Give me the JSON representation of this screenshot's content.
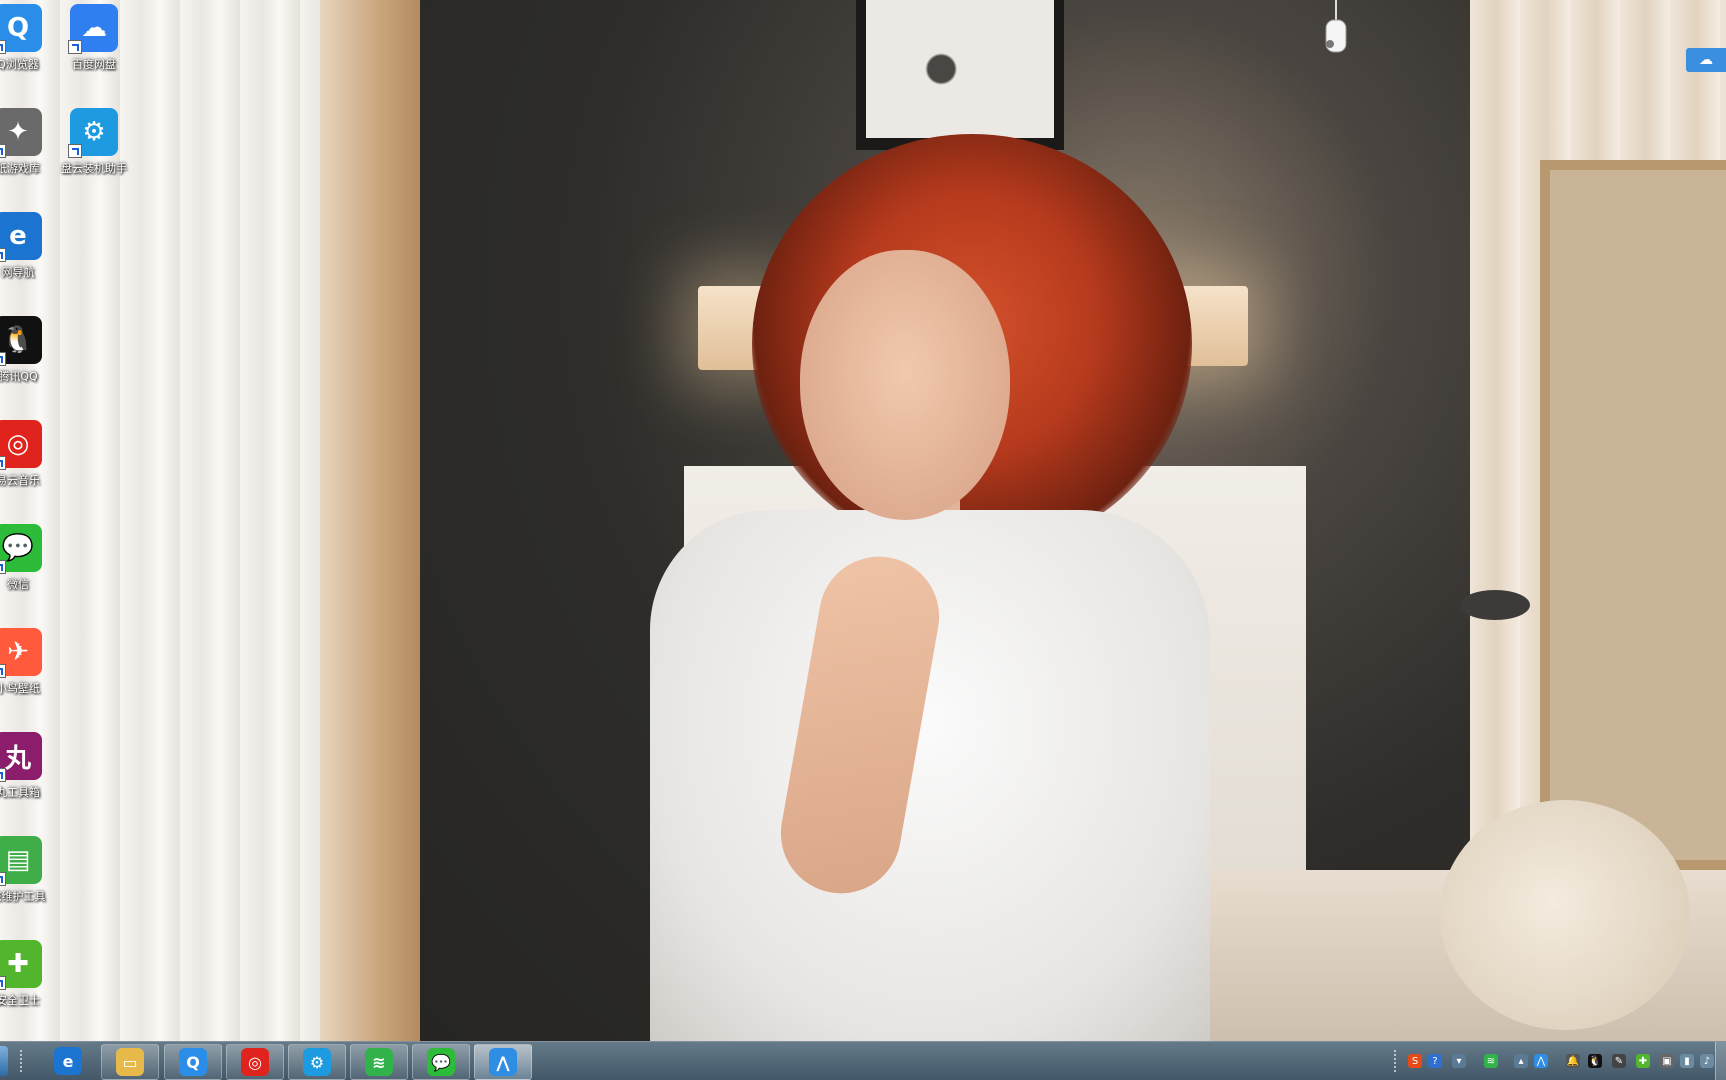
{
  "desktop": {
    "icons": [
      {
        "label": "Q浏览器",
        "icon": "qq-browser-icon",
        "color": "#2a8de8",
        "glyph": "Q"
      },
      {
        "label": "百度网盘",
        "icon": "baidu-netdisk-icon",
        "color": "#2f7ff0",
        "glyph": "☁"
      },
      {
        "label": "纸游戏库",
        "icon": "game-library-icon",
        "color": "#6a6a6a",
        "glyph": "✦"
      },
      {
        "label": "盘云装机助手",
        "icon": "install-helper-icon",
        "color": "#1e9be0",
        "glyph": "⚙"
      },
      {
        "label": "网导航",
        "icon": "ie-navigation-icon",
        "color": "#1b74d0",
        "glyph": "e"
      },
      {
        "label": "腾讯QQ",
        "icon": "qq-penguin-icon",
        "color": "#111111",
        "glyph": "🐧"
      },
      {
        "label": "易云音乐",
        "icon": "netease-music-icon",
        "color": "#e0231c",
        "glyph": "◎"
      },
      {
        "label": "微信",
        "icon": "wechat-icon",
        "color": "#2dbb3a",
        "glyph": "💬"
      },
      {
        "label": "小鸟壁纸",
        "icon": "bird-wallpaper-icon",
        "color": "#ff5a3c",
        "glyph": "✈"
      },
      {
        "label": "丸工具箱",
        "icon": "toolbox-icon",
        "color": "#8c1d6d",
        "glyph": "丸"
      },
      {
        "label": "统维护工具",
        "icon": "maintenance-tool-icon",
        "color": "#3fae49",
        "glyph": "▤"
      },
      {
        "label": "安全卫士",
        "icon": "security-guard-icon",
        "color": "#52b52e",
        "glyph": "✚"
      }
    ]
  },
  "taskbar": {
    "apps": [
      {
        "name": "ie-browser",
        "icon": "ie-icon",
        "color": "#1b74d0",
        "glyph": "e"
      },
      {
        "name": "file-explorer",
        "icon": "folder-icon",
        "color": "#e6b94a",
        "glyph": "▭"
      },
      {
        "name": "qq-browser",
        "icon": "qq-browser-icon",
        "color": "#2a8de8",
        "glyph": "Q"
      },
      {
        "name": "netease-music",
        "icon": "netease-music-icon",
        "color": "#e0231c",
        "glyph": "◎"
      },
      {
        "name": "install-helper",
        "icon": "install-helper-icon",
        "color": "#1e9be0",
        "glyph": "⚙"
      },
      {
        "name": "wifi-tool",
        "icon": "wifi-icon",
        "color": "#31b24a",
        "glyph": "≋"
      },
      {
        "name": "wechat",
        "icon": "wechat-icon",
        "color": "#2dbb3a",
        "glyph": "💬"
      },
      {
        "name": "active-app",
        "icon": "mountain-app-icon",
        "color": "#2f8de4",
        "glyph": "⋀"
      }
    ],
    "tray": [
      {
        "icon": "sogou-input-icon",
        "color": "#e64a19",
        "glyph": "S"
      },
      {
        "icon": "help-icon",
        "color": "#2f6fd0",
        "glyph": "?"
      },
      {
        "icon": "tray-expand-icon",
        "color": "#5a7a95",
        "glyph": "▾"
      },
      {
        "icon": "wifi-icon",
        "color": "#31b24a",
        "glyph": "≋"
      },
      {
        "icon": "show-hidden-icon",
        "color": "#5a7a95",
        "glyph": "▴"
      },
      {
        "icon": "app-tray-icon",
        "color": "#2f8de4",
        "glyph": "⋀"
      },
      {
        "icon": "notification-icon",
        "color": "#555555",
        "glyph": "🔔"
      },
      {
        "icon": "qq-tray-icon",
        "color": "#111111",
        "glyph": "🐧"
      },
      {
        "icon": "tool-tray-icon",
        "color": "#444444",
        "glyph": "✎"
      },
      {
        "icon": "security-tray-icon",
        "color": "#52b52e",
        "glyph": "✚"
      },
      {
        "icon": "network-tray-icon",
        "color": "#666666",
        "glyph": "▣"
      },
      {
        "icon": "signal-icon",
        "color": "#6c8aa0",
        "glyph": "▮"
      },
      {
        "icon": "volume-icon",
        "color": "#6c8aa0",
        "glyph": "♪"
      }
    ]
  },
  "widgets": {
    "floating_glyph": "☁"
  }
}
